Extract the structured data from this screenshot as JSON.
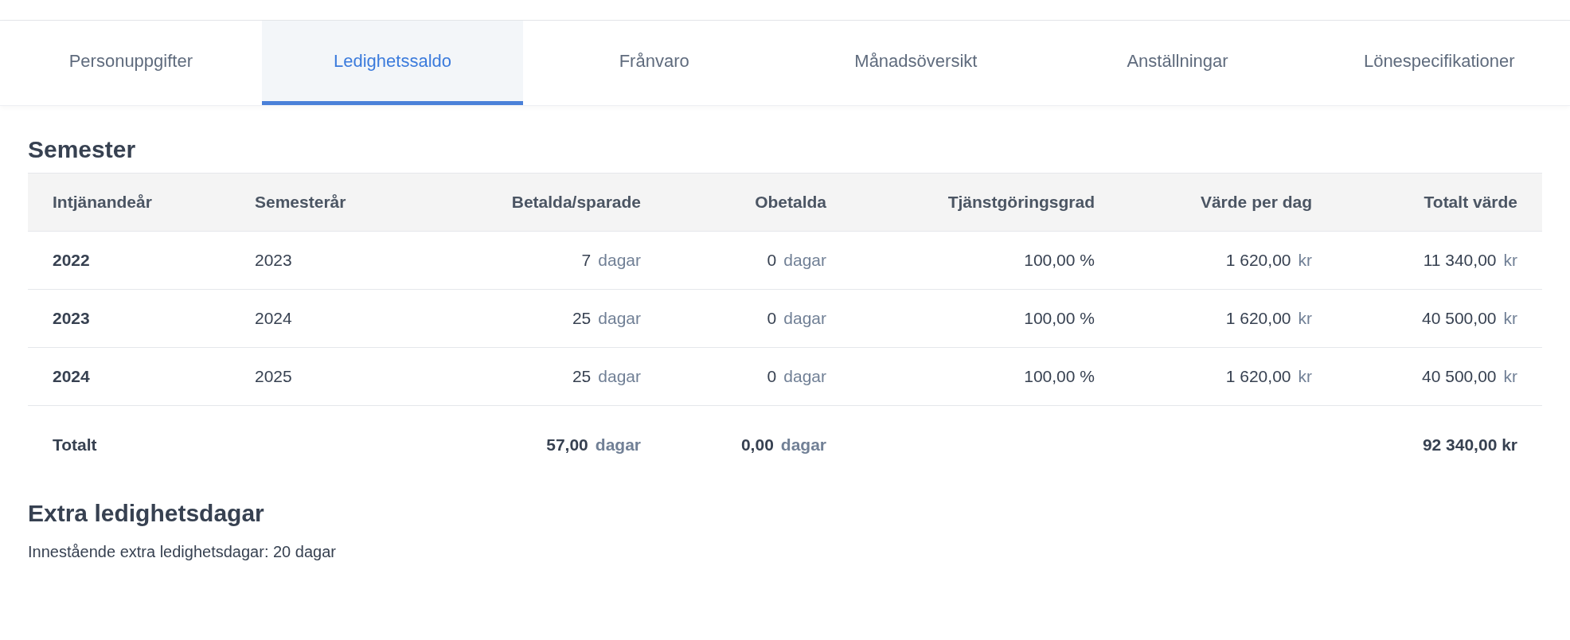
{
  "tabs": [
    {
      "label": "Personuppgifter",
      "selected": false
    },
    {
      "label": "Ledighetssaldo",
      "selected": true
    },
    {
      "label": "Frånvaro",
      "selected": false
    },
    {
      "label": "Månadsöversikt",
      "selected": false
    },
    {
      "label": "Anställningar",
      "selected": false
    },
    {
      "label": "Lönespecifikationer",
      "selected": false
    }
  ],
  "semester": {
    "title": "Semester",
    "table": {
      "columns": [
        "Intjänandeår",
        "Semesterår",
        "Betalda/sparade",
        "Obetalda",
        "Tjänstgöringsgrad",
        "Värde per dag",
        "Totalt värde"
      ],
      "rows": [
        {
          "earning_year": "2022",
          "vacation_year": "2023",
          "paid": {
            "value": "7",
            "unit": "dagar"
          },
          "unpaid": {
            "value": "0",
            "unit": "dagar"
          },
          "rate": "100,00 %",
          "per_day": {
            "value": "1 620,00",
            "unit": "kr"
          },
          "total": {
            "value": "11 340,00",
            "unit": "kr"
          }
        },
        {
          "earning_year": "2023",
          "vacation_year": "2024",
          "paid": {
            "value": "25",
            "unit": "dagar"
          },
          "unpaid": {
            "value": "0",
            "unit": "dagar"
          },
          "rate": "100,00 %",
          "per_day": {
            "value": "1 620,00",
            "unit": "kr"
          },
          "total": {
            "value": "40 500,00",
            "unit": "kr"
          }
        },
        {
          "earning_year": "2024",
          "vacation_year": "2025",
          "paid": {
            "value": "25",
            "unit": "dagar"
          },
          "unpaid": {
            "value": "0",
            "unit": "dagar"
          },
          "rate": "100,00 %",
          "per_day": {
            "value": "1 620,00",
            "unit": "kr"
          },
          "total": {
            "value": "40 500,00",
            "unit": "kr"
          }
        }
      ],
      "totals": {
        "label": "Totalt",
        "paid": {
          "value": "57,00",
          "unit": "dagar"
        },
        "unpaid": {
          "value": "0,00",
          "unit": "dagar"
        },
        "total": "92 340,00 kr"
      }
    }
  },
  "extra": {
    "title": "Extra ledighetsdagar",
    "text": "Innestående extra ledighetsdagar: 20 dagar"
  }
}
